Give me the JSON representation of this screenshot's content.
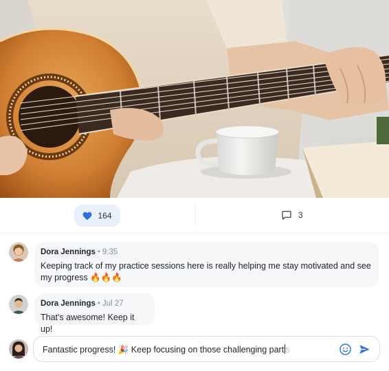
{
  "post": {
    "image_alt": "Person playing an acoustic guitar next to a white mug",
    "likes": "164",
    "liked": true,
    "comments_count": "3"
  },
  "comments": [
    {
      "author": "Dora Jennings",
      "time": "9:35",
      "text": "Keeping track of my practice sessions here is really helping me stay motivated and see my progress 🔥🔥🔥"
    },
    {
      "author": "Dora Jennings",
      "time": "Jul 27",
      "text": "That's awesome! Keep it up!"
    }
  ],
  "composer": {
    "value": "Fantastic progress! 🎉 Keep focusing on those challenging part",
    "ghost_suggestion": "s"
  },
  "icons": {
    "like": "heart-icon",
    "comment": "comment-bubble-icon",
    "emoji": "smiley-icon",
    "send": "send-icon"
  },
  "colors": {
    "accent": "#2f6fdf",
    "like_bg": "#e9f0fc",
    "bubble_bg": "#f5f6f8"
  },
  "separator": "•"
}
